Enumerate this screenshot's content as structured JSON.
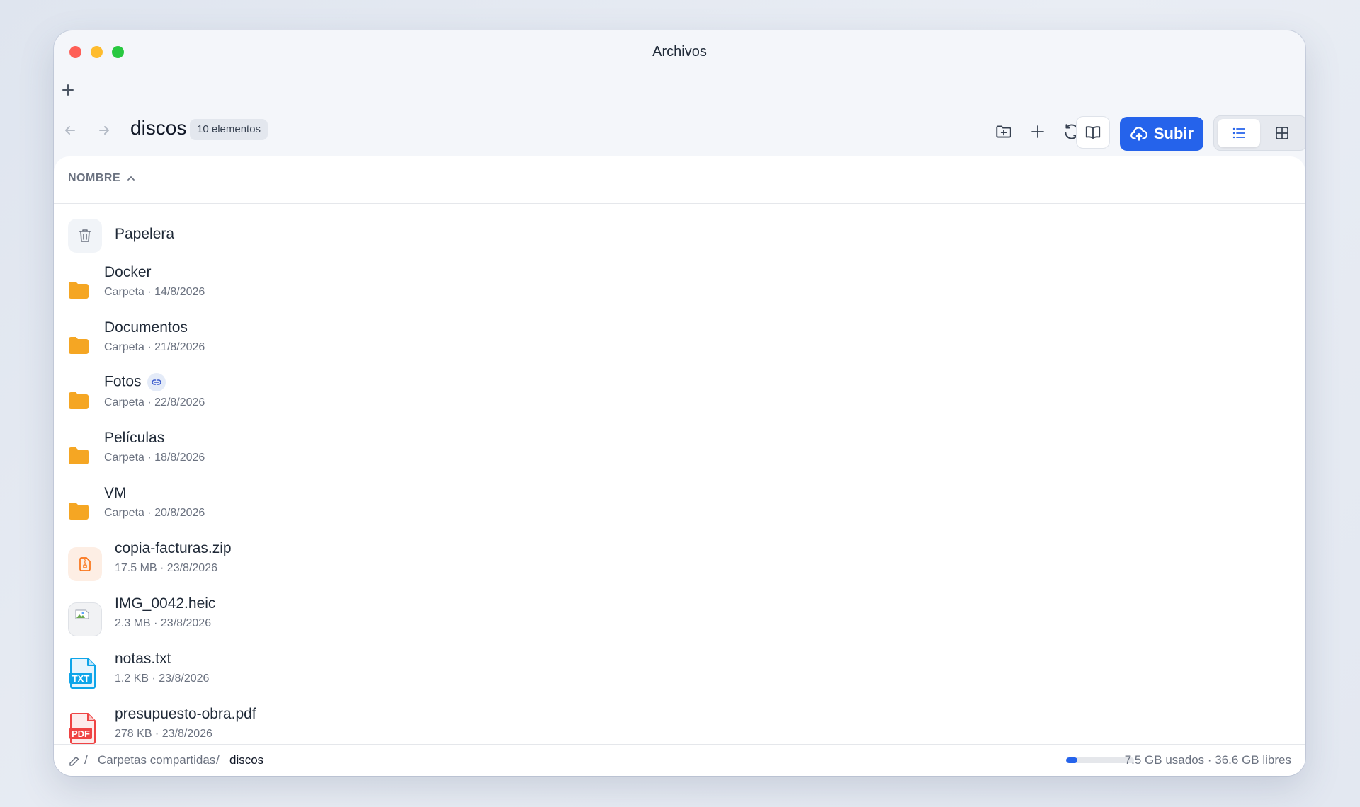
{
  "window": {
    "title": "Archivos"
  },
  "toolbar": {
    "folder_name": "discos",
    "item_count": "10 elementos",
    "upload_label": "Subir"
  },
  "list": {
    "column_header": "NOMBRE",
    "items": [
      {
        "name": "Papelera",
        "meta": "",
        "icon": "trash-icon"
      },
      {
        "name": "Docker",
        "meta": "Carpeta · 14/8/2026",
        "icon": "folder-icon"
      },
      {
        "name": "Documentos",
        "meta": "Carpeta · 21/8/2026",
        "icon": "folder-icon"
      },
      {
        "name": "Fotos",
        "meta": "Carpeta · 22/8/2026",
        "icon": "folder-icon",
        "shared": true
      },
      {
        "name": "Películas",
        "meta": "Carpeta · 18/8/2026",
        "icon": "folder-icon"
      },
      {
        "name": "VM",
        "meta": "Carpeta · 20/8/2026",
        "icon": "folder-icon"
      },
      {
        "name": "copia-facturas.zip",
        "meta": "17.5 MB · 23/8/2026",
        "icon": "zip-file-icon"
      },
      {
        "name": "IMG_0042.heic",
        "meta": "2.3 MB · 23/8/2026",
        "icon": "image-thumbnail-icon"
      },
      {
        "name": "notas.txt",
        "meta": "1.2 KB · 23/8/2026",
        "icon": "txt-file-icon",
        "label": "TXT"
      },
      {
        "name": "presupuesto-obra.pdf",
        "meta": "278 KB · 23/8/2026",
        "icon": "pdf-file-icon",
        "label": "PDF"
      }
    ]
  },
  "statusbar": {
    "crumb_sep": "/",
    "breadcrumb_1": "Carpetas compartidas",
    "breadcrumb_2": "discos",
    "usage_text": "7.5 GB usados · 36.6 GB libres",
    "usage_fraction": 0.17
  },
  "colors": {
    "accent": "#2563eb",
    "folder": "#f5a623",
    "zip": "#f97316",
    "txt": "#0ea5e9",
    "pdf": "#ef4444"
  }
}
